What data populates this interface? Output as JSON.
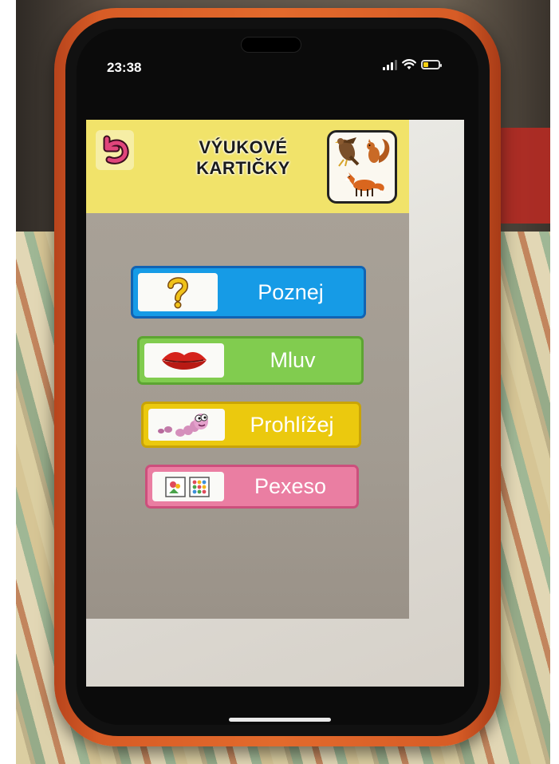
{
  "status_bar": {
    "time": "23:38",
    "signal_icon": "signal-bars-icon",
    "wifi_icon": "wifi-icon",
    "battery_icon": "battery-icon",
    "battery_level": 0.35
  },
  "header": {
    "title_line1": "VÝUKOVÉ",
    "title_line2": "KARTIČKY",
    "back_icon": "undo-arrow-icon",
    "illustration": "animals-icon",
    "background_color": "#f1e36a"
  },
  "menu": [
    {
      "label": "Poznej",
      "icon": "question-mark-icon",
      "color": "#169be6"
    },
    {
      "label": "Mluv",
      "icon": "lips-icon",
      "color": "#81cc4f"
    },
    {
      "label": "Prohlížej",
      "icon": "worm-icon",
      "color": "#ebc90e"
    },
    {
      "label": "Pexeso",
      "icon": "memory-cards-icon",
      "color": "#ea7ea2"
    }
  ]
}
